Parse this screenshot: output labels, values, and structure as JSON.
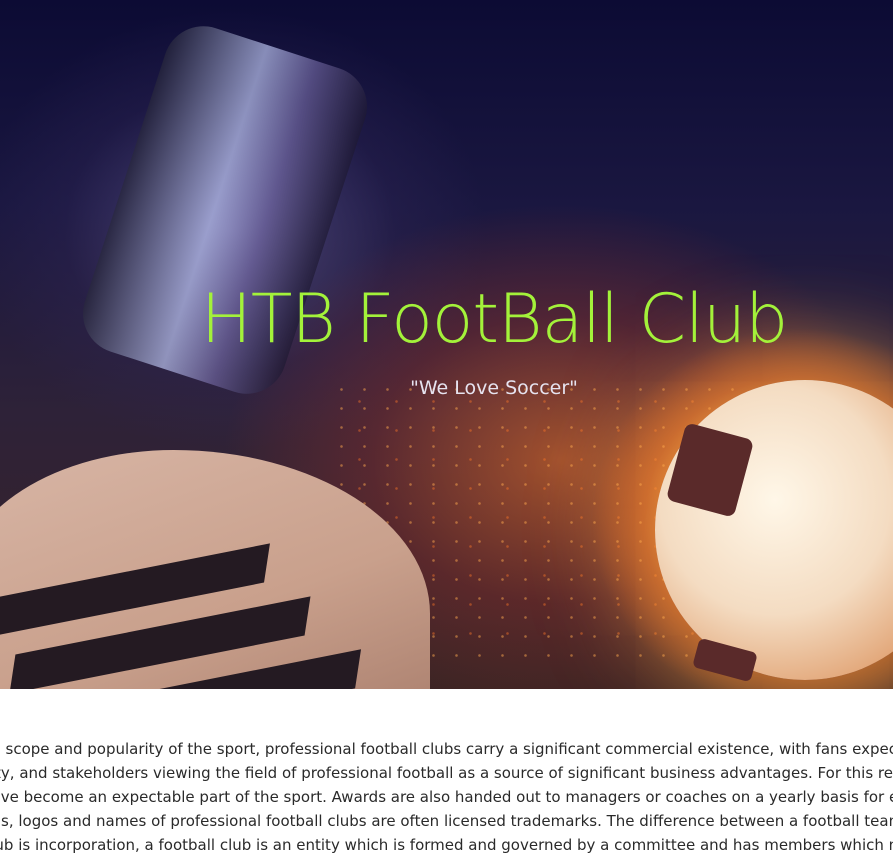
{
  "hero": {
    "title": "HTB FootBall Club",
    "subtitle": "\"We Love Soccer\"",
    "title_color": "#a3f23a"
  },
  "article": {
    "lines": [
      "he scope and popularity of the sport, professional football clubs carry a significant commercial existence, with fans expecting",
      "vity, and stakeholders viewing the field of professional football as a source of significant business advantages. For this reason",
      " have become an expectable part of the sport. Awards are also handed out to managers or coaches on a yearly basis for exce",
      "gns, logos and names of professional football clubs are often licensed trademarks. The difference between a football team an",
      "club is incorporation, a football club is an entity which is formed and governed by a committee and has members which may c"
    ]
  }
}
